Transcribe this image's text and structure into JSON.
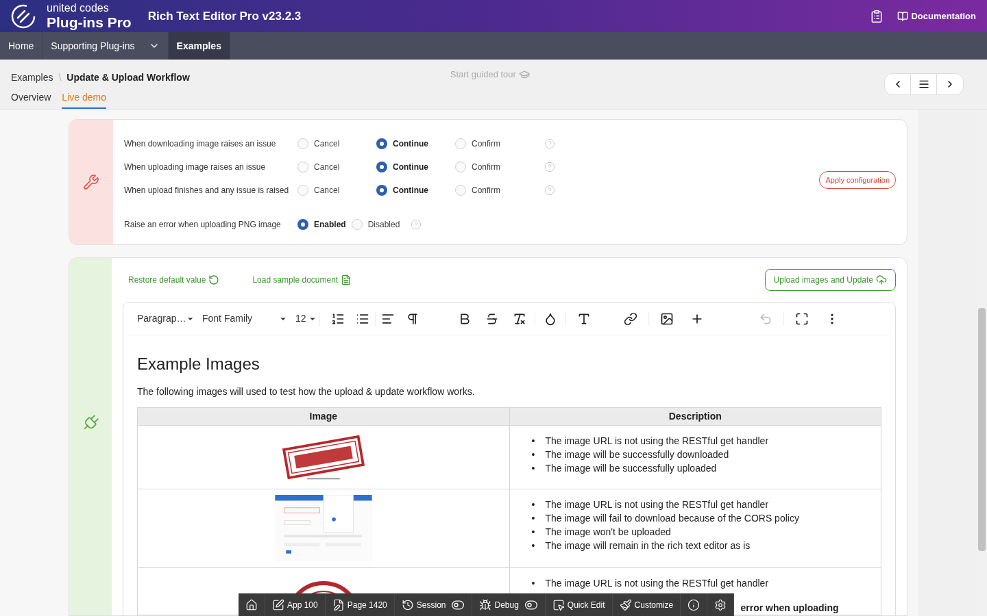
{
  "header": {
    "logo_top": "united codes",
    "logo_bottom": "Plug-ins Pro",
    "app_title": "Rich Text Editor Pro v23.2.3",
    "documentation": "Documentation"
  },
  "nav": [
    {
      "label": "Home",
      "selected": false,
      "has_menu": false
    },
    {
      "label": "Supporting Plug-ins",
      "selected": false,
      "has_menu": true
    },
    {
      "label": "Examples",
      "selected": true,
      "has_menu": false
    }
  ],
  "breadcrumb": [
    "Examples",
    "Update & Upload Workflow"
  ],
  "breadcrumb_separator": "\\",
  "guided_tour": "Start guided tour",
  "tabs": [
    {
      "label": "Overview",
      "selected": false
    },
    {
      "label": "Live demo",
      "selected": true
    }
  ],
  "config": {
    "rows": [
      {
        "label": "When downloading image raises an issue",
        "options": [
          {
            "label": "Cancel",
            "selected": false
          },
          {
            "label": "Continue",
            "selected": true
          },
          {
            "label": "Confirm",
            "selected": false
          }
        ]
      },
      {
        "label": "When uploading image raises an issue",
        "options": [
          {
            "label": "Cancel",
            "selected": false
          },
          {
            "label": "Continue",
            "selected": true
          },
          {
            "label": "Confirm",
            "selected": false
          }
        ]
      },
      {
        "label": "When upload finishes and any issue is raised",
        "options": [
          {
            "label": "Cancel",
            "selected": false
          },
          {
            "label": "Continue",
            "selected": true
          },
          {
            "label": "Confirm",
            "selected": false
          }
        ]
      }
    ],
    "png_row": {
      "label": "Raise an error when uploading PNG image",
      "options": [
        {
          "label": "Enabled",
          "selected": true
        },
        {
          "label": "Disabled",
          "selected": false
        }
      ]
    },
    "apply": "Apply configuration"
  },
  "actions": {
    "restore": "Restore default value",
    "load_sample": "Load sample document",
    "upload": "Upload images and Update"
  },
  "editor": {
    "block_format": "Paragrap…",
    "font_family": "Font Family",
    "font_size": "12",
    "heading": "Example Images",
    "paragraph": "The following images will used to test how the upload & update workflow works.",
    "columns": [
      "Image",
      "Description"
    ],
    "rows": [
      {
        "image": {
          "kind": "stamp"
        },
        "bullets": [
          {
            "marker": "•",
            "text": "The image URL is not using the RESTful get handler",
            "bold": false
          },
          {
            "marker": "•",
            "text": "The image will be successfully downloaded",
            "bold": false
          },
          {
            "marker": "•",
            "text": "The image will be successfully uploaded",
            "bold": false
          }
        ]
      },
      {
        "image": {
          "kind": "screenshot"
        },
        "bullets": [
          {
            "marker": "•",
            "text": "The image URL is not using the RESTful get handler",
            "bold": false
          },
          {
            "marker": "•",
            "text": "The image will fail to download because of the CORS policy",
            "bold": false
          },
          {
            "marker": "•",
            "text": "The image won't be uploaded",
            "bold": false
          },
          {
            "marker": "•",
            "text": "The image will remain in the rich text editor as is",
            "bold": false
          }
        ]
      },
      {
        "image": {
          "kind": "round_stamp"
        },
        "bullets": [
          {
            "marker": "•",
            "text": "The image URL is not using the RESTful get handler",
            "bold": false
          },
          {
            "text": "error when uploading",
            "bold": true
          }
        ]
      }
    ]
  },
  "dev_toolbar": [
    {
      "kind": "home"
    },
    {
      "kind": "app",
      "label": "App 100"
    },
    {
      "kind": "page",
      "label": "Page 1420"
    },
    {
      "kind": "session",
      "label": "Session"
    },
    {
      "kind": "debug",
      "label": "Debug"
    },
    {
      "kind": "quick_edit",
      "label": "Quick Edit"
    },
    {
      "kind": "customize",
      "label": "Customize"
    },
    {
      "kind": "info"
    },
    {
      "kind": "settings"
    }
  ]
}
